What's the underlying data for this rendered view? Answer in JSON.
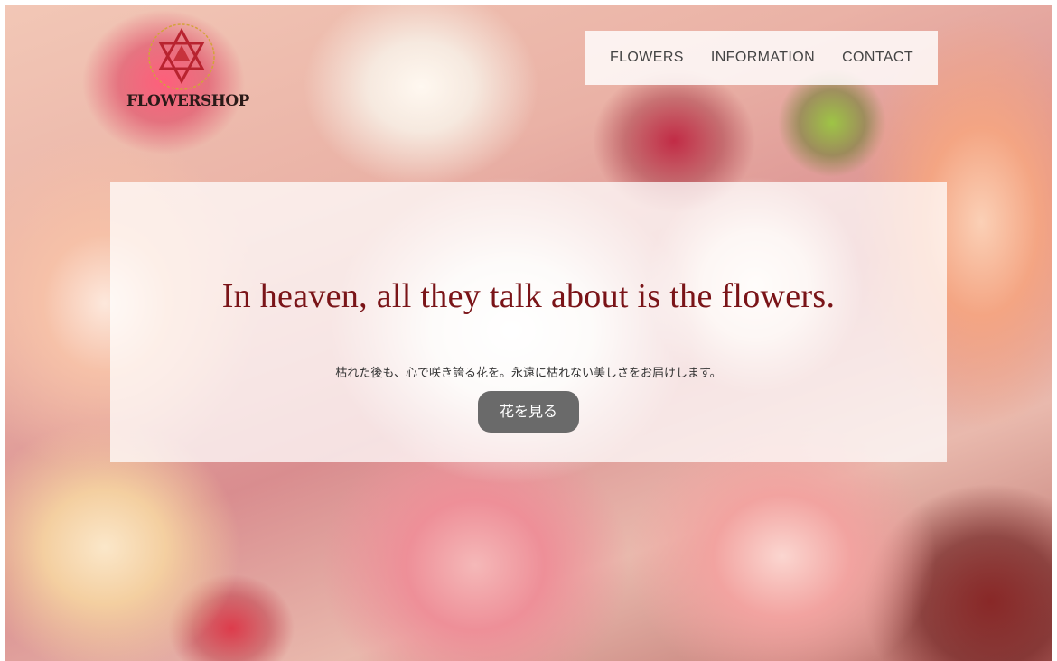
{
  "brand": {
    "name": "FLOWERSHOP",
    "accent": "#7a1418",
    "logo_icon": "star-of-david-flower-icon"
  },
  "nav": {
    "items": [
      {
        "label": "FLOWERS"
      },
      {
        "label": "INFORMATION"
      },
      {
        "label": "CONTACT"
      }
    ]
  },
  "hero": {
    "title": "In heaven, all they talk about is the flowers.",
    "subtitle": "枯れた後も、心で咲き誇る花を。永遠に枯れない美しさをお届けします。",
    "button_label": "花を見る",
    "button_color": "#6a6a6a"
  },
  "background": {
    "description_icon": "flower-bouquet-background"
  }
}
